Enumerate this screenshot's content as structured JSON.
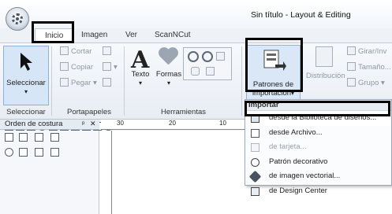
{
  "window": {
    "title": "Sin título - Layout & Editing"
  },
  "tabs": [
    {
      "label": "Inicio",
      "active": true
    },
    {
      "label": "Imagen"
    },
    {
      "label": "Ver"
    },
    {
      "label": "ScanNCut"
    }
  ],
  "ribbon": {
    "groups": {
      "seleccionar": "Seleccionar",
      "portapapeles": "Portapapeles",
      "herramientas": "Herramientas",
      "importar": "Importar"
    },
    "seleccionar_btn": "Seleccionar",
    "clipboard": {
      "cut": "Cortar",
      "copy": "Copiar",
      "paste": "Pegar"
    },
    "tools": {
      "text": "Texto",
      "shapes": "Formas"
    },
    "import_btn": {
      "line1": "Patrones de",
      "line2": "importación"
    },
    "layout": {
      "distribution": "Distribución",
      "rotate": "Girar/Inv",
      "size": "Tamaño...",
      "group": "Grupo"
    }
  },
  "panel": {
    "title": "Orden de costura",
    "pin": "ᵖ",
    "close": "✕"
  },
  "ruler": {
    "marks": [
      "30",
      "20",
      "10"
    ]
  },
  "import_menu": {
    "header": "Importar",
    "items": [
      {
        "label": "desde la Biblioteca de diseños...",
        "icon": "library-icon",
        "enabled": true
      },
      {
        "label": "desde Archivo...",
        "icon": "file-icon",
        "enabled": true
      },
      {
        "label": "de tarjeta...",
        "icon": "card-icon",
        "enabled": false
      },
      {
        "label": "Patrón decorativo",
        "icon": "decorative-pattern-icon",
        "enabled": true
      },
      {
        "label": "de imagen vectorial...",
        "icon": "vector-image-icon",
        "enabled": true
      },
      {
        "label": "de Design Center",
        "icon": "design-center-icon",
        "enabled": true
      }
    ]
  },
  "colors": {
    "accent": "#d6e6f7",
    "accent_border": "#8fb1d8",
    "highlight": "#000000"
  }
}
